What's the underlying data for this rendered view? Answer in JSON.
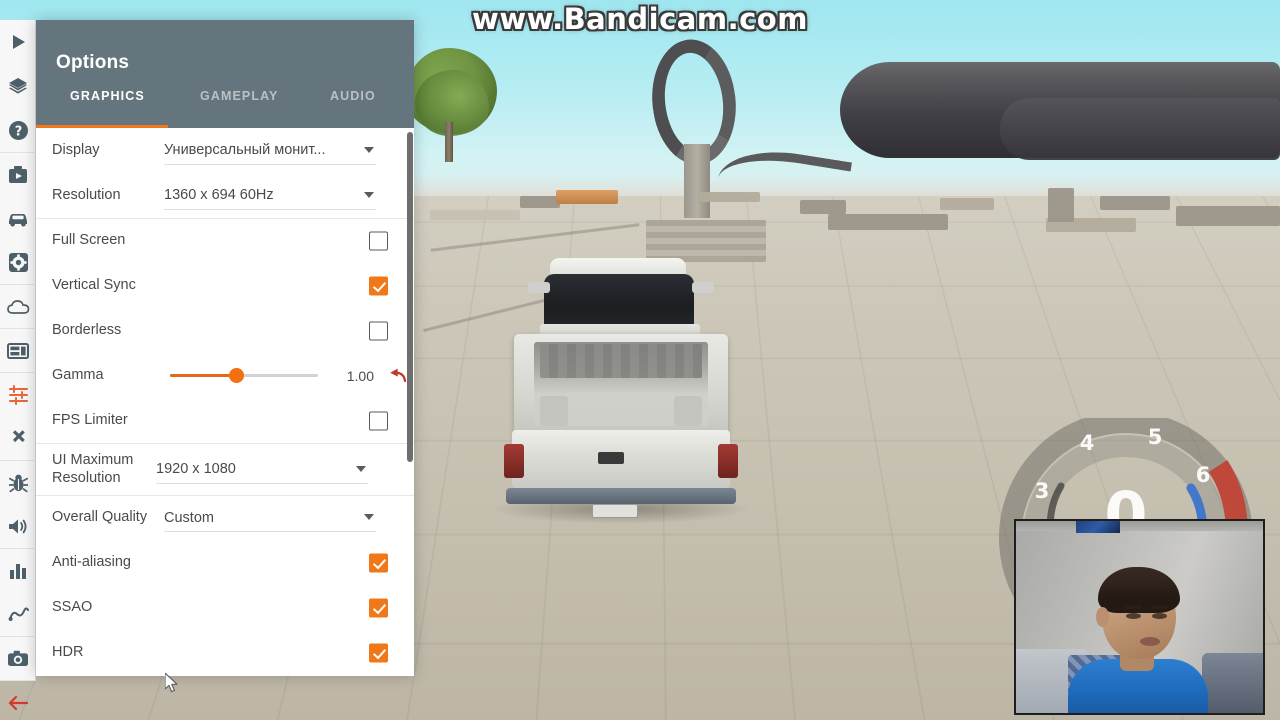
{
  "watermark": {
    "text": "www.Bandicam.com"
  },
  "sidebar": {
    "items": [
      {
        "name": "play-icon",
        "label": "Play"
      },
      {
        "name": "layers-icon",
        "label": "Layers"
      },
      {
        "name": "help-icon",
        "label": "Help"
      },
      {
        "name": "scenarios-icon",
        "label": "Scenarios"
      },
      {
        "name": "vehicles-icon",
        "label": "Vehicles"
      },
      {
        "name": "settings-icon",
        "label": "Settings"
      },
      {
        "name": "environment-icon",
        "label": "Environment"
      },
      {
        "name": "layout-icon",
        "label": "Layout"
      },
      {
        "name": "sliders-icon",
        "label": "Options"
      },
      {
        "name": "move-icon",
        "label": "Move"
      },
      {
        "name": "debug-icon",
        "label": "Debug"
      },
      {
        "name": "audio-icon",
        "label": "Audio"
      },
      {
        "name": "stats-icon",
        "label": "Statistics"
      },
      {
        "name": "node-path-icon",
        "label": "Node Path"
      },
      {
        "name": "camera-icon",
        "label": "Screenshot"
      },
      {
        "name": "back-arrow-icon",
        "label": "Back"
      }
    ]
  },
  "panel": {
    "title": "Options",
    "tabs": [
      {
        "label": "GRAPHICS",
        "active": true
      },
      {
        "label": "GAMEPLAY",
        "active": false
      },
      {
        "label": "AUDIO",
        "active": false
      }
    ],
    "accent_color": "#f07818",
    "header_color": "#64757d",
    "rows": {
      "display": {
        "label": "Display",
        "value": "Универсальный монит..."
      },
      "resolution": {
        "label": "Resolution",
        "value": "1360 x 694 60Hz"
      },
      "full_screen": {
        "label": "Full Screen",
        "checked": false
      },
      "vertical_sync": {
        "label": "Vertical Sync",
        "checked": true
      },
      "borderless": {
        "label": "Borderless",
        "checked": false
      },
      "gamma": {
        "label": "Gamma",
        "value": "1.00",
        "percent": 45,
        "reset_icon": "undo-icon"
      },
      "fps_limiter": {
        "label": "FPS Limiter",
        "checked": false
      },
      "ui_maximum_resolution": {
        "label": "UI Maximum Resolution",
        "value": "1920 x 1080"
      },
      "overall_quality": {
        "label": "Overall Quality",
        "value": "Custom"
      },
      "anti_aliasing": {
        "label": "Anti-aliasing",
        "checked": true
      },
      "ssao": {
        "label": "SSAO",
        "checked": true
      },
      "hdr": {
        "label": "HDR",
        "checked": true
      }
    }
  },
  "tachometer": {
    "ticks": [
      "3",
      "4",
      "5",
      "6"
    ],
    "speed_value": "0",
    "redline_color": "#c0392b",
    "arc_color": "#2f6fd0"
  }
}
